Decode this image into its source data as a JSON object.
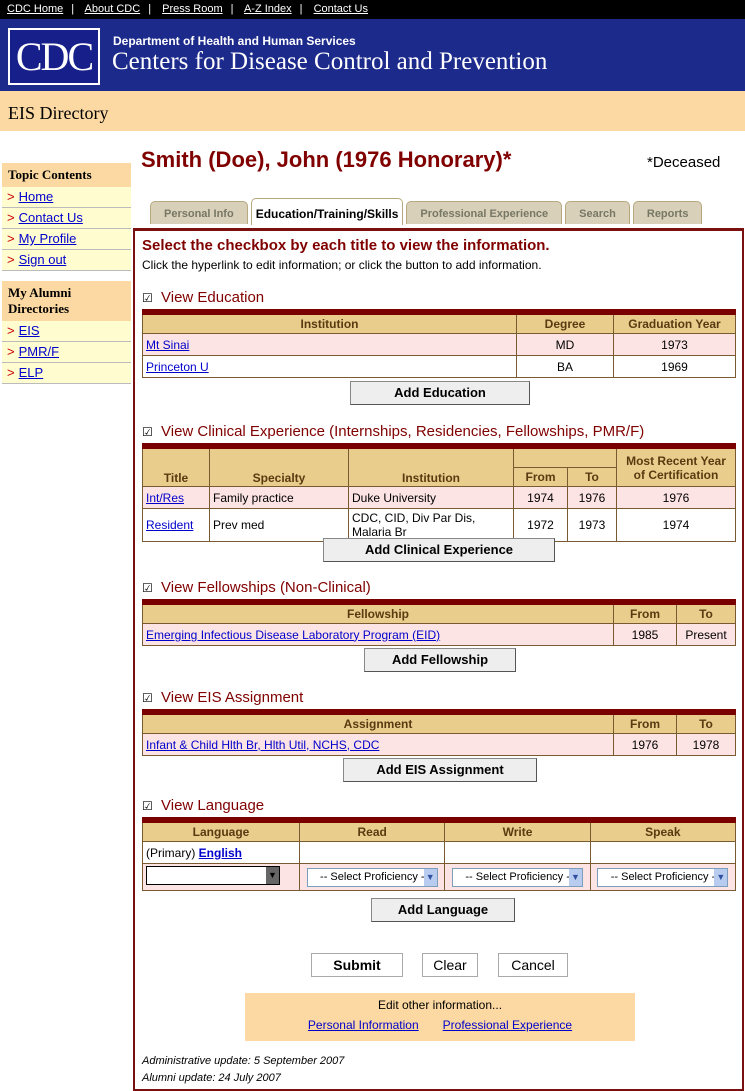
{
  "topnav": [
    "CDC Home",
    "About CDC",
    "Press Room",
    "A-Z Index",
    "Contact Us"
  ],
  "banner": {
    "logo": "CDC",
    "dept": "Department of Health and Human Services",
    "agency": "Centers for Disease Control and Prevention"
  },
  "directory_title": "EIS Directory",
  "sidebar": {
    "topic_heading": "Topic Contents",
    "topic_items": [
      "Home",
      "Contact Us",
      "My Profile",
      "Sign out"
    ],
    "alumni_heading": "My Alumni Directories",
    "alumni_items": [
      "EIS",
      "PMR/F",
      "ELP"
    ]
  },
  "person": {
    "name": "Smith (Doe), John (1976 Honorary)*",
    "note": "*Deceased"
  },
  "tabs": [
    "Personal Info",
    "Education/Training/Skills",
    "Professional Experience",
    "Search",
    "Reports"
  ],
  "instructions": {
    "title": "Select the checkbox by each title to view the information.",
    "text": "Click the hyperlink to edit information; or click the button to add information."
  },
  "education": {
    "title": "View Education",
    "headers": [
      "Institution",
      "Degree",
      "Graduation Year"
    ],
    "rows": [
      [
        "Mt Sinai",
        "MD",
        "1973"
      ],
      [
        "Princeton U",
        "BA",
        "1969"
      ]
    ],
    "button": "Add Education"
  },
  "clinical": {
    "title": "View Clinical Experience (Internships, Residencies, Fellowships, PMR/F)",
    "headers": [
      "Title",
      "Specialty",
      "Institution",
      "From",
      "To",
      "Most Recent Year of Certification"
    ],
    "rows": [
      [
        "Int/Res",
        "Family practice",
        "Duke University",
        "1974",
        "1976",
        "1976"
      ],
      [
        "Resident",
        "Prev med",
        "CDC, CID, Div Par Dis, Malaria Br",
        "1972",
        "1973",
        "1974"
      ]
    ],
    "button": "Add Clinical Experience"
  },
  "fellowships": {
    "title": "View Fellowships (Non-Clinical)",
    "headers": [
      "Fellowship",
      "From",
      "To"
    ],
    "rows": [
      [
        "Emerging Infectious Disease Laboratory Program (EID)",
        "1985",
        "Present"
      ]
    ],
    "button": "Add Fellowship"
  },
  "eis": {
    "title": "View EIS Assignment",
    "headers": [
      "Assignment",
      "From",
      "To"
    ],
    "rows": [
      [
        "Infant & Child Hlth Br, Hlth Util, NCHS, CDC",
        "1976",
        "1978"
      ]
    ],
    "button": "Add EIS Assignment"
  },
  "language": {
    "title": "View Language",
    "headers": [
      "Language",
      "Read",
      "Write",
      "Speak"
    ],
    "primary_label": "(Primary)",
    "primary": "English",
    "select_placeholder": "-- Select Proficiency --",
    "button": "Add Language"
  },
  "actions": {
    "submit": "Submit",
    "clear": "Clear",
    "cancel": "Cancel"
  },
  "edit_other": {
    "label": "Edit other information...",
    "links": [
      "Personal Information",
      "Professional Experience"
    ]
  },
  "updates": {
    "admin": "Administrative update: 5 September 2007",
    "alumni": "Alumni update: 24 July 2007"
  },
  "colors": {
    "banner": "#1c2a8c",
    "tan": "#fcd9a2",
    "maroon": "#800000",
    "row_pink": "#fde4e4",
    "header_tan": "#e9cd8c"
  }
}
